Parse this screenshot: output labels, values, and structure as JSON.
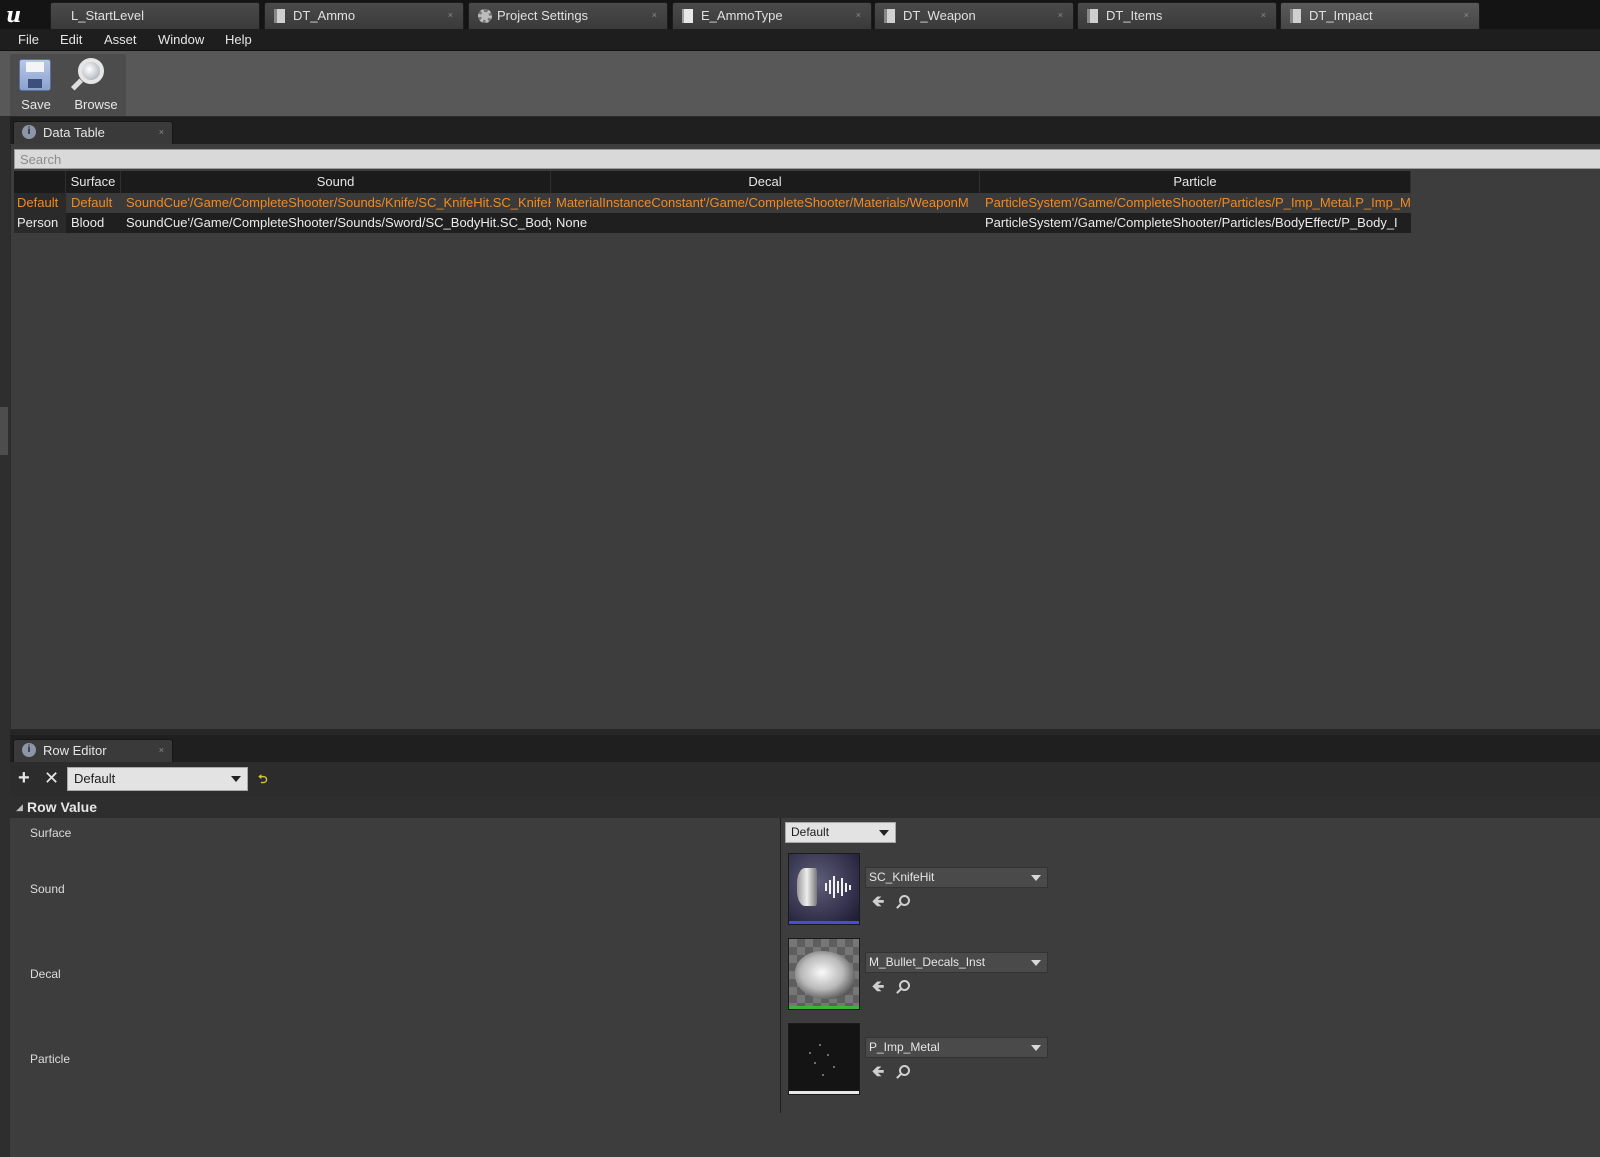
{
  "tabs": [
    {
      "label": "L_StartLevel",
      "icon": "ue-logo"
    },
    {
      "label": "DT_Ammo",
      "icon": "datatable-icon"
    },
    {
      "label": "Project Settings",
      "icon": "gear-icon"
    },
    {
      "label": "E_AmmoType",
      "icon": "enum-icon"
    },
    {
      "label": "DT_Weapon",
      "icon": "datatable-icon"
    },
    {
      "label": "DT_Items",
      "icon": "datatable-icon"
    },
    {
      "label": "DT_Impact",
      "icon": "datatable-icon",
      "active": true
    }
  ],
  "menu": [
    "File",
    "Edit",
    "Asset",
    "Window",
    "Help"
  ],
  "toolbar": {
    "save_label": "Save",
    "browse_label": "Browse"
  },
  "datatable": {
    "tab_label": "Data Table",
    "search_placeholder": "Search",
    "columns": [
      "Surface",
      "Sound",
      "Decal",
      "Particle"
    ],
    "rows": [
      {
        "name": "Default",
        "surface": "Default",
        "sound": "SoundCue'/Game/CompleteShooter/Sounds/Knife/SC_KnifeHit.SC_KnifeHit'",
        "decal": "MaterialInstanceConstant'/Game/CompleteShooter/Materials/WeaponM",
        "particle": "ParticleSystem'/Game/CompleteShooter/Particles/P_Imp_Metal.P_Imp_M",
        "selected": true
      },
      {
        "name": "Person",
        "surface": "Blood",
        "sound": "SoundCue'/Game/CompleteShooter/Sounds/Sword/SC_BodyHit.SC_BodyHit'",
        "decal": "None",
        "particle": "ParticleSystem'/Game/CompleteShooter/Particles/BodyEffect/P_Body_I",
        "selected": false
      }
    ]
  },
  "row_editor": {
    "tab_label": "Row Editor",
    "selected_row": "Default",
    "section_title": "Row Value",
    "properties": {
      "surface": {
        "label": "Surface",
        "value": "Default"
      },
      "sound": {
        "label": "Sound",
        "value": "SC_KnifeHit"
      },
      "decal": {
        "label": "Decal",
        "value": "M_Bullet_Decals_Inst"
      },
      "particle": {
        "label": "Particle",
        "value": "P_Imp_Metal"
      }
    }
  },
  "colors": {
    "selected_text": "#f08a24",
    "sound_bar": "#4b4bd6",
    "decal_bar": "#3cb43c",
    "particle_bar": "#e8e8e8"
  }
}
